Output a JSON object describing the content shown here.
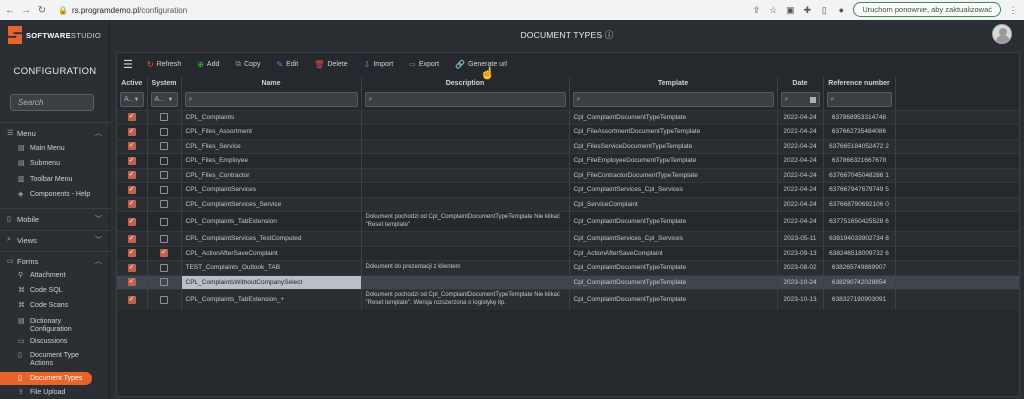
{
  "browser": {
    "url_domain": "rs.programdemo.pl",
    "url_path": "/configuration",
    "update_label": "Uruchom ponownie, aby zaktualizować"
  },
  "app": {
    "logo_bold": "SOFTWARE",
    "logo_rest": "STUDIO",
    "sidebar_title": "CONFIGURATION",
    "search_placeholder": "Search",
    "page_title": "DOCUMENT TYPES ⓘ"
  },
  "sidebar": {
    "menu_group": "Menu",
    "menu_items": [
      "Main Menu",
      "Submenu",
      "Toolbar Menu",
      "Components - Help"
    ],
    "mobile_group": "Mobile",
    "views_group": "Views",
    "forms_group": "Forms",
    "forms_items": [
      "Attachment",
      "Code SQL",
      "Code Scans",
      "Dictionary Configuration",
      "Discussions",
      "Document Type Actions",
      "Document Types",
      "File Upload"
    ],
    "active_item": "Document Types"
  },
  "toolbar": {
    "refresh": "Refresh",
    "add": "Add",
    "copy": "Copy",
    "edit": "Edit",
    "delete": "Delete",
    "import": "Import",
    "export": "Export",
    "generate_url": "Generate url"
  },
  "table": {
    "headers": {
      "active": "Active",
      "system": "System",
      "name": "Name",
      "description": "Description",
      "template": "Template",
      "date": "Date",
      "reference": "Reference number"
    },
    "filters": {
      "active": "A..",
      "system": "A.."
    },
    "rows": [
      {
        "active": true,
        "system": false,
        "name": "CPL_Complaints",
        "description": "",
        "template": "Cpl_ComplaintDocumentTypeTemplate",
        "date": "2022-04-24",
        "ref": "637868953314748"
      },
      {
        "active": true,
        "system": false,
        "name": "CPL_Files_Assortment",
        "description": "",
        "template": "Cpl_FileAssortmentDocumentTypeTemplate",
        "date": "2022-04-24",
        "ref": "637662735484086"
      },
      {
        "active": true,
        "system": false,
        "name": "CPL_Files_Service",
        "description": "",
        "template": "Cpl_FilesServiceDocumentTypeTemplate",
        "date": "2022-04-24",
        "ref": "637665184052472 2"
      },
      {
        "active": true,
        "system": false,
        "name": "CPL_Files_Employee",
        "description": "",
        "template": "Cpl_FileEmployeeDocumentTypeTemplate",
        "date": "2022-04-24",
        "ref": "637866321667678"
      },
      {
        "active": true,
        "system": false,
        "name": "CPL_Files_Contractor",
        "description": "",
        "template": "Cpl_FileContractorDocumentTypeTemplate",
        "date": "2022-04-24",
        "ref": "637667045048286 1"
      },
      {
        "active": true,
        "system": false,
        "name": "CPL_ComplaintServices",
        "description": "",
        "template": "Cpl_ComplaintServices_Cpl_Services",
        "date": "2022-04-24",
        "ref": "637667947679749 5"
      },
      {
        "active": true,
        "system": false,
        "name": "CPL_ComplaintServices_Service",
        "description": "",
        "template": "Cpl_ServiceComplaint",
        "date": "2022-04-24",
        "ref": "637668790692106 0"
      },
      {
        "active": true,
        "system": false,
        "name": "CPL_Complaints_TabExtension",
        "description": "Dokument pochodzi od Cpl_ComplaintDocumentTypeTemplate Nie klikać \"Reset template\"",
        "template": "Cpl_ComplaintDocumentTypeTemplate",
        "date": "2022-04-24",
        "ref": "637751650425528 6",
        "tall": true
      },
      {
        "active": true,
        "system": false,
        "name": "CPL_ComplaintServices_TestComputed",
        "description": "",
        "template": "Cpl_ComplaintServices_Cpl_Services",
        "date": "2023-05-11",
        "ref": "638194033902734 8"
      },
      {
        "active": true,
        "system": true,
        "name": "CPL_ActionAfterSaveComplaint",
        "description": "",
        "template": "Cpl_ActionAfterSaveComplaint",
        "date": "2023-09-13",
        "ref": "638246518009732 6"
      },
      {
        "active": true,
        "system": false,
        "name": "TEST_Complaints_Outlook_TAB",
        "description": "Dokument do prezentacji z klientem",
        "template": "Cpl_ComplaintDocumentTypeTemplate",
        "date": "2023-08-02",
        "ref": "638265749889907"
      },
      {
        "active": true,
        "system": false,
        "name": "CPL_ComplaintsWithoutCompanySelect",
        "description": "",
        "template": "Cpl_ComplaintDocumentTypeTemplate",
        "date": "2023-10-24",
        "ref": "638290742028854",
        "selected": true
      },
      {
        "active": true,
        "system": false,
        "name": "CPL_Complaints_TabExtension_+",
        "description": "Dokument pochodzi od Cpl_ComplaintDocumentTypeTemplate Nie klikać \"Reset template\". Wersja rozszerzona o logistykę itp.",
        "template": "Cpl_ComplaintDocumentTypeTemplate",
        "date": "2023-10-13",
        "ref": "638327190903091",
        "tall": true
      }
    ]
  },
  "colors": {
    "accent": "#e8642b",
    "checkbox": "#c2604a",
    "background": "#2b2f33"
  }
}
